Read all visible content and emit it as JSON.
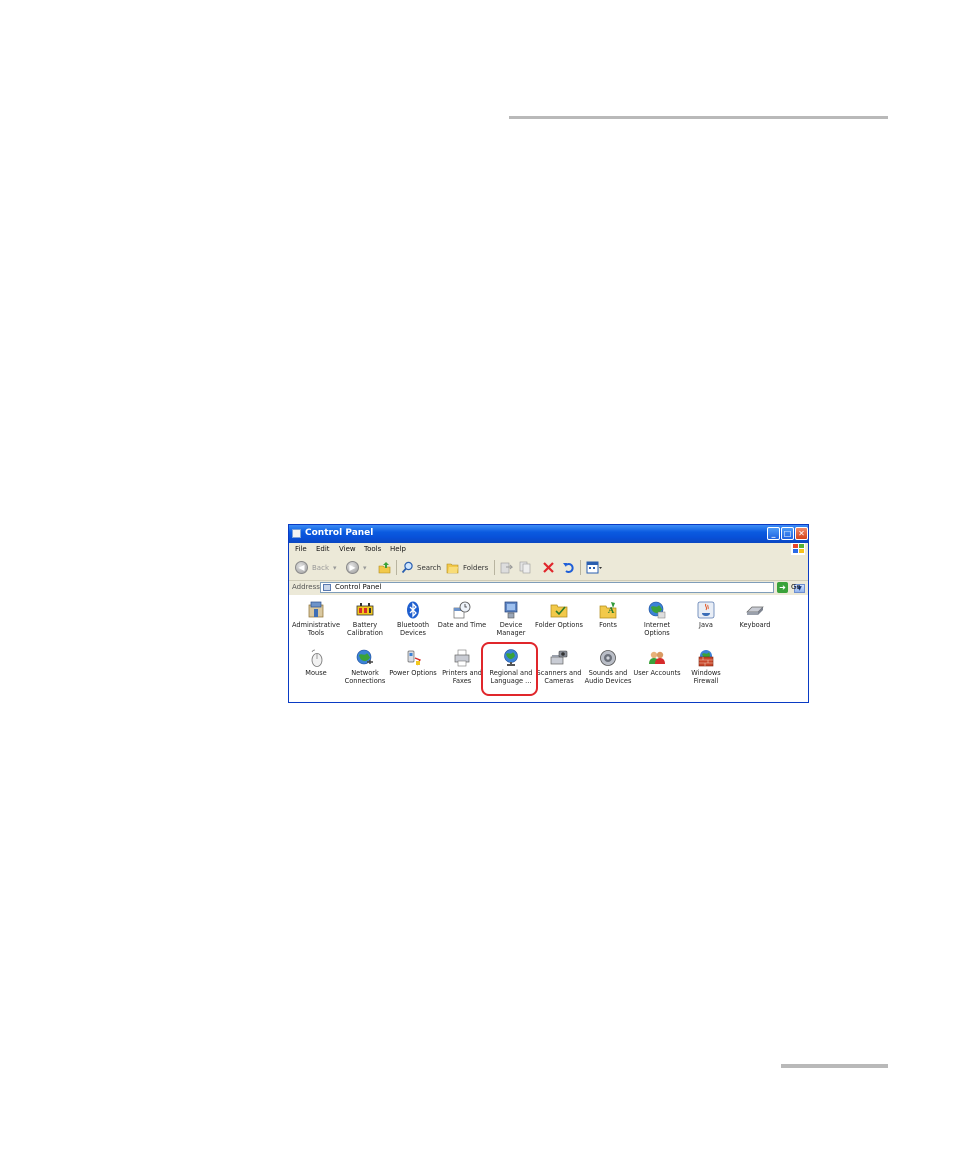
{
  "window": {
    "title": "Control Panel",
    "minimize": "_",
    "maximize": "□",
    "close": "✕"
  },
  "menu": [
    "File",
    "Edit",
    "View",
    "Tools",
    "Help"
  ],
  "toolbar": {
    "back_label": "Back",
    "search_label": "Search",
    "folders_label": "Folders"
  },
  "address": {
    "label": "Address",
    "value": "Control Panel",
    "go_label": "Go"
  },
  "items": [
    {
      "line1": "Administrative",
      "line2": "Tools"
    },
    {
      "line1": "Battery",
      "line2": "Calibration"
    },
    {
      "line1": "Bluetooth",
      "line2": "Devices"
    },
    {
      "line1": "Date and Time",
      "line2": ""
    },
    {
      "line1": "Device",
      "line2": "Manager"
    },
    {
      "line1": "Folder Options",
      "line2": ""
    },
    {
      "line1": "Fonts",
      "line2": ""
    },
    {
      "line1": "Internet",
      "line2": "Options"
    },
    {
      "line1": "Java",
      "line2": ""
    },
    {
      "line1": "Keyboard",
      "line2": ""
    },
    {
      "line1": "Mouse",
      "line2": ""
    },
    {
      "line1": "Network",
      "line2": "Connections"
    },
    {
      "line1": "Power Options",
      "line2": ""
    },
    {
      "line1": "Printers and",
      "line2": "Faxes"
    },
    {
      "line1": "Regional and",
      "line2": "Language ..."
    },
    {
      "line1": "Scanners and",
      "line2": "Cameras"
    },
    {
      "line1": "Sounds and",
      "line2": "Audio Devices"
    },
    {
      "line1": "User Accounts",
      "line2": ""
    },
    {
      "line1": "Windows",
      "line2": "Firewall"
    }
  ],
  "colors": {
    "titlebar": "#0a5ae0",
    "chrome": "#ece9d8",
    "highlight_ring": "#e0262b"
  }
}
